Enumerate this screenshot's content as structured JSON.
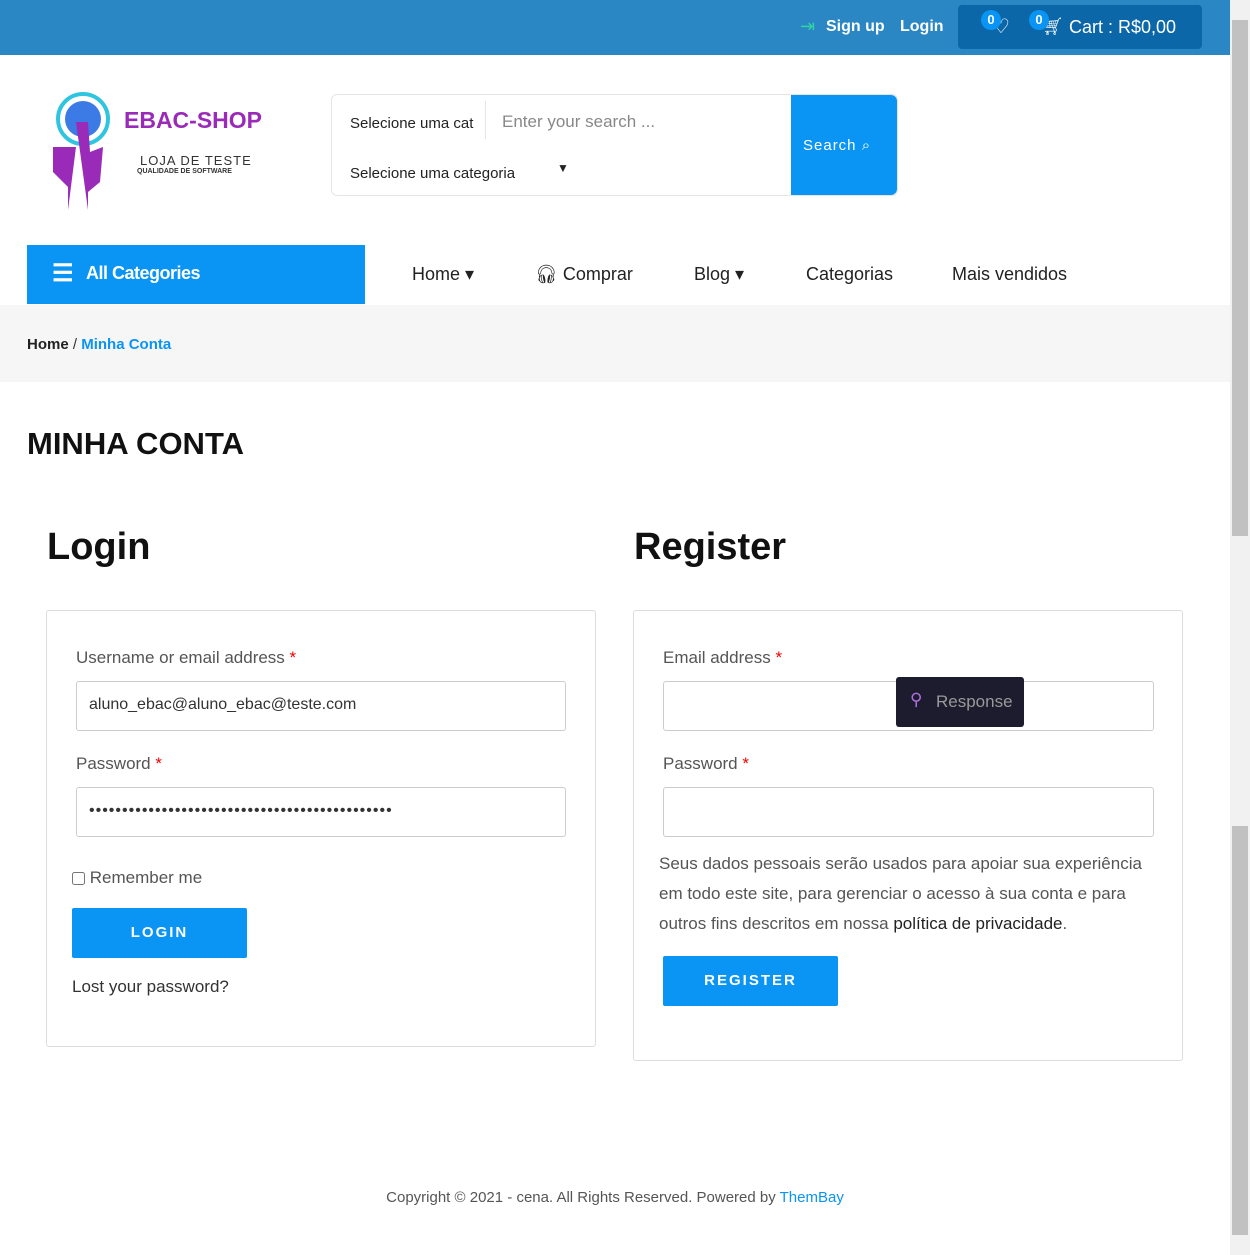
{
  "topbar": {
    "signup": "Sign up",
    "login": "Login",
    "wishlist_count": "0",
    "cart_count": "0",
    "cart_label": "Cart : R$0,00"
  },
  "logo": {
    "title": "EBAC-SHOP",
    "subtitle": "LOJA DE TESTE",
    "tagline": "QUALIDADE DE SOFTWARE"
  },
  "search": {
    "category_short": "Selecione uma cat",
    "category_select": "Selecione uma categoria",
    "placeholder": "Enter your search ...",
    "button": "Search"
  },
  "nav": {
    "all_categories": "All Categories",
    "items": [
      "Home",
      "Comprar",
      "Blog",
      "Categorias",
      "Mais vendidos"
    ]
  },
  "breadcrumb": {
    "home": "Home",
    "sep": "/",
    "current": "Minha Conta"
  },
  "page_title": "MINHA CONTA",
  "login": {
    "title": "Login",
    "username_label": "Username or email address",
    "username_value": "aluno_ebac@aluno_ebac@teste.com",
    "password_label": "Password",
    "password_value": "••••••••••••••••••••••••••••••••••••••••••••••",
    "remember": "Remember me",
    "button": "LOGIN",
    "lost": "Lost your password?"
  },
  "register": {
    "title": "Register",
    "email_label": "Email address",
    "password_label": "Password",
    "tooltip": "Response",
    "privacy_text": "Seus dados pessoais serão usados para apoiar sua experiência em todo este site, para gerenciar o acesso à sua conta e para outros fins descritos em nossa ",
    "privacy_link": "política de privacidade",
    "privacy_end": ".",
    "button": "REGISTER"
  },
  "footer": {
    "text": "Copyright © 2021 - cena. All Rights Reserved. Powered by ",
    "link": "ThemBay"
  }
}
